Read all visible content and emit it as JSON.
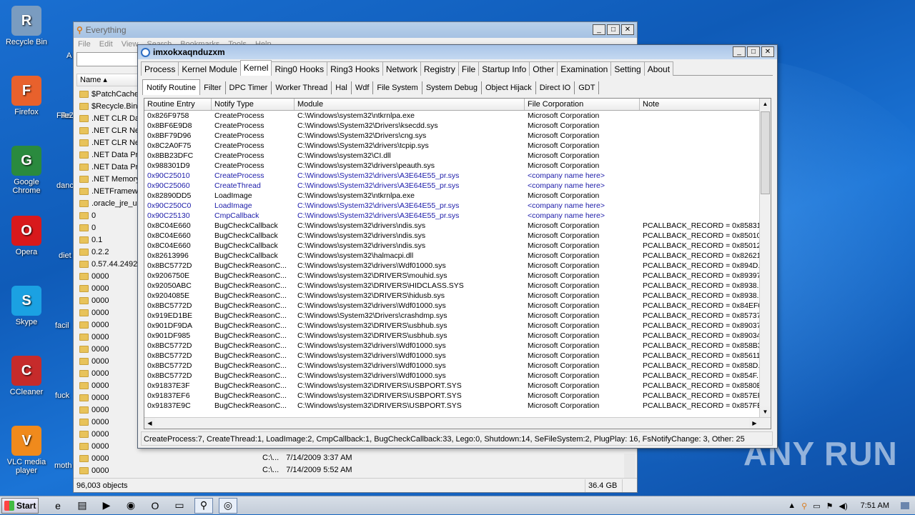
{
  "desktop": {
    "icons": [
      {
        "label": "Recycle Bin",
        "icon": "recycle-bin-icon",
        "color": "#7a9cc0"
      },
      {
        "label": "Firefox",
        "icon": "firefox-icon",
        "color": "#e8612c"
      },
      {
        "label": "Google Chrome",
        "icon": "chrome-icon",
        "color": "#2a8a3e"
      },
      {
        "label": "Opera",
        "icon": "opera-icon",
        "color": "#d8191c"
      },
      {
        "label": "Skype",
        "icon": "skype-icon",
        "color": "#1ba1e2"
      },
      {
        "label": "CCleaner",
        "icon": "ccleaner-icon",
        "color": "#c62b2b"
      },
      {
        "label": "VLC media player",
        "icon": "vlc-icon",
        "color": "#f08a1c"
      }
    ],
    "partial_labels": [
      "A",
      "Re",
      "FileZ",
      "danc",
      "diet",
      "facil",
      "fuck",
      "moth"
    ]
  },
  "everything": {
    "title": "Everything",
    "menu": [
      "File",
      "Edit",
      "View",
      "Search",
      "Bookmarks",
      "Tools",
      "Help"
    ],
    "column_name": "Name",
    "folders": [
      "$PatchCache",
      "$Recycle.Bin",
      ".NET CLR Dat",
      ".NET CLR Net",
      ".NET CLR Net",
      ".NET Data Pr",
      ".NET Data Pr",
      ".NET Memory",
      ".NETFramew",
      ".oracle_jre_u",
      "0",
      "0",
      "0.1",
      "0.2.2",
      "0.57.44.2492",
      "0000",
      "0000",
      "0000",
      "0000",
      "0000",
      "0000",
      "0000",
      "0000",
      "0000",
      "0000",
      "0000",
      "0000",
      "0000",
      "0000",
      "0000",
      "0000",
      "0000"
    ],
    "bottom_rows": [
      {
        "path": "C:\\...",
        "date": "7/14/2009 3:37 AM"
      },
      {
        "path": "C:\\...",
        "date": "7/14/2009 5:52 AM"
      }
    ],
    "status_objects": "96,003 objects",
    "status_size": "36.4 GB"
  },
  "pchunter": {
    "title": "imxokxaqnduzxm",
    "main_tabs": [
      "Process",
      "Kernel Module",
      "Kernel",
      "Ring0 Hooks",
      "Ring3 Hooks",
      "Network",
      "Registry",
      "File",
      "Startup Info",
      "Other",
      "Examination",
      "Setting",
      "About"
    ],
    "active_main_tab": "Kernel",
    "sub_tabs": [
      "Notify Routine",
      "Filter",
      "DPC Timer",
      "Worker Thread",
      "Hal",
      "Wdf",
      "File System",
      "System Debug",
      "Object Hijack",
      "Direct IO",
      "GDT"
    ],
    "active_sub_tab": "Notify Routine",
    "columns": [
      "Routine Entry",
      "Notify Type",
      "Module",
      "File Corporation",
      "Note"
    ],
    "rows": [
      {
        "entry": "0x826F9758",
        "type": "CreateProcess",
        "module": "C:\\Windows\\system32\\ntkrnlpa.exe",
        "corp": "Microsoft Corporation",
        "note": "",
        "suspicious": false
      },
      {
        "entry": "0x8BF6E9D8",
        "type": "CreateProcess",
        "module": "C:\\Windows\\System32\\Drivers\\ksecdd.sys",
        "corp": "Microsoft Corporation",
        "note": "",
        "suspicious": false
      },
      {
        "entry": "0x8BF79D96",
        "type": "CreateProcess",
        "module": "C:\\Windows\\System32\\Drivers\\cng.sys",
        "corp": "Microsoft Corporation",
        "note": "",
        "suspicious": false
      },
      {
        "entry": "0x8C2A0F75",
        "type": "CreateProcess",
        "module": "C:\\Windows\\System32\\drivers\\tcpip.sys",
        "corp": "Microsoft Corporation",
        "note": "",
        "suspicious": false
      },
      {
        "entry": "0x8BB23DFC",
        "type": "CreateProcess",
        "module": "C:\\Windows\\system32\\CI.dll",
        "corp": "Microsoft Corporation",
        "note": "",
        "suspicious": false
      },
      {
        "entry": "0x988301D9",
        "type": "CreateProcess",
        "module": "C:\\Windows\\system32\\drivers\\peauth.sys",
        "corp": "Microsoft Corporation",
        "note": "",
        "suspicious": false
      },
      {
        "entry": "0x90C25010",
        "type": "CreateProcess",
        "module": "C:\\Windows\\System32\\drivers\\A3E64E55_pr.sys",
        "corp": "<company name here>",
        "note": "",
        "suspicious": true
      },
      {
        "entry": "0x90C25060",
        "type": "CreateThread",
        "module": "C:\\Windows\\System32\\drivers\\A3E64E55_pr.sys",
        "corp": "<company name here>",
        "note": "",
        "suspicious": true
      },
      {
        "entry": "0x82890DD5",
        "type": "LoadImage",
        "module": "C:\\Windows\\system32\\ntkrnlpa.exe",
        "corp": "Microsoft Corporation",
        "note": "",
        "suspicious": false
      },
      {
        "entry": "0x90C250C0",
        "type": "LoadImage",
        "module": "C:\\Windows\\System32\\drivers\\A3E64E55_pr.sys",
        "corp": "<company name here>",
        "note": "",
        "suspicious": true
      },
      {
        "entry": "0x90C25130",
        "type": "CmpCallback",
        "module": "C:\\Windows\\System32\\drivers\\A3E64E55_pr.sys",
        "corp": "<company name here>",
        "note": "",
        "suspicious": true
      },
      {
        "entry": "0x8C04E660",
        "type": "BugCheckCallback",
        "module": "C:\\Windows\\system32\\drivers\\ndis.sys",
        "corp": "Microsoft Corporation",
        "note": "PCALLBACK_RECORD = 0x85831...",
        "suspicious": false
      },
      {
        "entry": "0x8C04E660",
        "type": "BugCheckCallback",
        "module": "C:\\Windows\\system32\\drivers\\ndis.sys",
        "corp": "Microsoft Corporation",
        "note": "PCALLBACK_RECORD = 0x85010...",
        "suspicious": false
      },
      {
        "entry": "0x8C04E660",
        "type": "BugCheckCallback",
        "module": "C:\\Windows\\system32\\drivers\\ndis.sys",
        "corp": "Microsoft Corporation",
        "note": "PCALLBACK_RECORD = 0x85012...",
        "suspicious": false
      },
      {
        "entry": "0x82613996",
        "type": "BugCheckCallback",
        "module": "C:\\Windows\\system32\\halmacpi.dll",
        "corp": "Microsoft Corporation",
        "note": "PCALLBACK_RECORD = 0x82621...",
        "suspicious": false
      },
      {
        "entry": "0x8BC5772D",
        "type": "BugCheckReasonC...",
        "module": "C:\\Windows\\system32\\drivers\\Wdf01000.sys",
        "corp": "Microsoft Corporation",
        "note": "PCALLBACK_RECORD = 0x894D...",
        "suspicious": false
      },
      {
        "entry": "0x9206750E",
        "type": "BugCheckReasonC...",
        "module": "C:\\Windows\\system32\\DRIVERS\\mouhid.sys",
        "corp": "Microsoft Corporation",
        "note": "PCALLBACK_RECORD = 0x89397...",
        "suspicious": false
      },
      {
        "entry": "0x92050ABC",
        "type": "BugCheckReasonC...",
        "module": "C:\\Windows\\system32\\DRIVERS\\HIDCLASS.SYS",
        "corp": "Microsoft Corporation",
        "note": "PCALLBACK_RECORD = 0x8938...",
        "suspicious": false
      },
      {
        "entry": "0x9204085E",
        "type": "BugCheckReasonC...",
        "module": "C:\\Windows\\system32\\DRIVERS\\hidusb.sys",
        "corp": "Microsoft Corporation",
        "note": "PCALLBACK_RECORD = 0x8938...",
        "suspicious": false
      },
      {
        "entry": "0x8BC5772D",
        "type": "BugCheckReasonC...",
        "module": "C:\\Windows\\system32\\drivers\\Wdf01000.sys",
        "corp": "Microsoft Corporation",
        "note": "PCALLBACK_RECORD = 0x84EF0...",
        "suspicious": false
      },
      {
        "entry": "0x919ED1BE",
        "type": "BugCheckReasonC...",
        "module": "C:\\Windows\\System32\\Drivers\\crashdmp.sys",
        "corp": "Microsoft Corporation",
        "note": "PCALLBACK_RECORD = 0x85737...",
        "suspicious": false
      },
      {
        "entry": "0x901DF9DA",
        "type": "BugCheckReasonC...",
        "module": "C:\\Windows\\system32\\DRIVERS\\usbhub.sys",
        "corp": "Microsoft Corporation",
        "note": "PCALLBACK_RECORD = 0x89037...",
        "suspicious": false
      },
      {
        "entry": "0x901DF985",
        "type": "BugCheckReasonC...",
        "module": "C:\\Windows\\system32\\DRIVERS\\usbhub.sys",
        "corp": "Microsoft Corporation",
        "note": "PCALLBACK_RECORD = 0x89034...",
        "suspicious": false
      },
      {
        "entry": "0x8BC5772D",
        "type": "BugCheckReasonC...",
        "module": "C:\\Windows\\system32\\drivers\\Wdf01000.sys",
        "corp": "Microsoft Corporation",
        "note": "PCALLBACK_RECORD = 0x858B3...",
        "suspicious": false
      },
      {
        "entry": "0x8BC5772D",
        "type": "BugCheckReasonC...",
        "module": "C:\\Windows\\system32\\drivers\\Wdf01000.sys",
        "corp": "Microsoft Corporation",
        "note": "PCALLBACK_RECORD = 0x85611...",
        "suspicious": false
      },
      {
        "entry": "0x8BC5772D",
        "type": "BugCheckReasonC...",
        "module": "C:\\Windows\\system32\\drivers\\Wdf01000.sys",
        "corp": "Microsoft Corporation",
        "note": "PCALLBACK_RECORD = 0x858D...",
        "suspicious": false
      },
      {
        "entry": "0x8BC5772D",
        "type": "BugCheckReasonC...",
        "module": "C:\\Windows\\system32\\drivers\\Wdf01000.sys",
        "corp": "Microsoft Corporation",
        "note": "PCALLBACK_RECORD = 0x854F...",
        "suspicious": false
      },
      {
        "entry": "0x91837E3F",
        "type": "BugCheckReasonC...",
        "module": "C:\\Windows\\system32\\DRIVERS\\USBPORT.SYS",
        "corp": "Microsoft Corporation",
        "note": "PCALLBACK_RECORD = 0x8580E...",
        "suspicious": false
      },
      {
        "entry": "0x91837EF6",
        "type": "BugCheckReasonC...",
        "module": "C:\\Windows\\system32\\DRIVERS\\USBPORT.SYS",
        "corp": "Microsoft Corporation",
        "note": "PCALLBACK_RECORD = 0x857EF...",
        "suspicious": false
      },
      {
        "entry": "0x91837E9C",
        "type": "BugCheckReasonC...",
        "module": "C:\\Windows\\system32\\DRIVERS\\USBPORT.SYS",
        "corp": "Microsoft Corporation",
        "note": "PCALLBACK_RECORD = 0x857FB...",
        "suspicious": false
      }
    ],
    "status": "CreateProcess:7, CreateThread:1, LoadImage:2, CmpCallback:1, BugCheckCallback:33, Lego:0, Shutdown:14, SeFileSystem:2, PlugPlay: 16, FsNotifyChange: 3, Other: 25",
    "suspicious_color": "#1a1aa8"
  },
  "taskbar": {
    "start_label": "Start",
    "apps": [
      "ie-icon",
      "explorer-icon",
      "media-player-icon",
      "chrome-icon",
      "opera-icon",
      "window-icon",
      "everything-icon",
      "pchunter-icon"
    ],
    "clock": "7:51 AM"
  },
  "watermark": "ANY RUN"
}
